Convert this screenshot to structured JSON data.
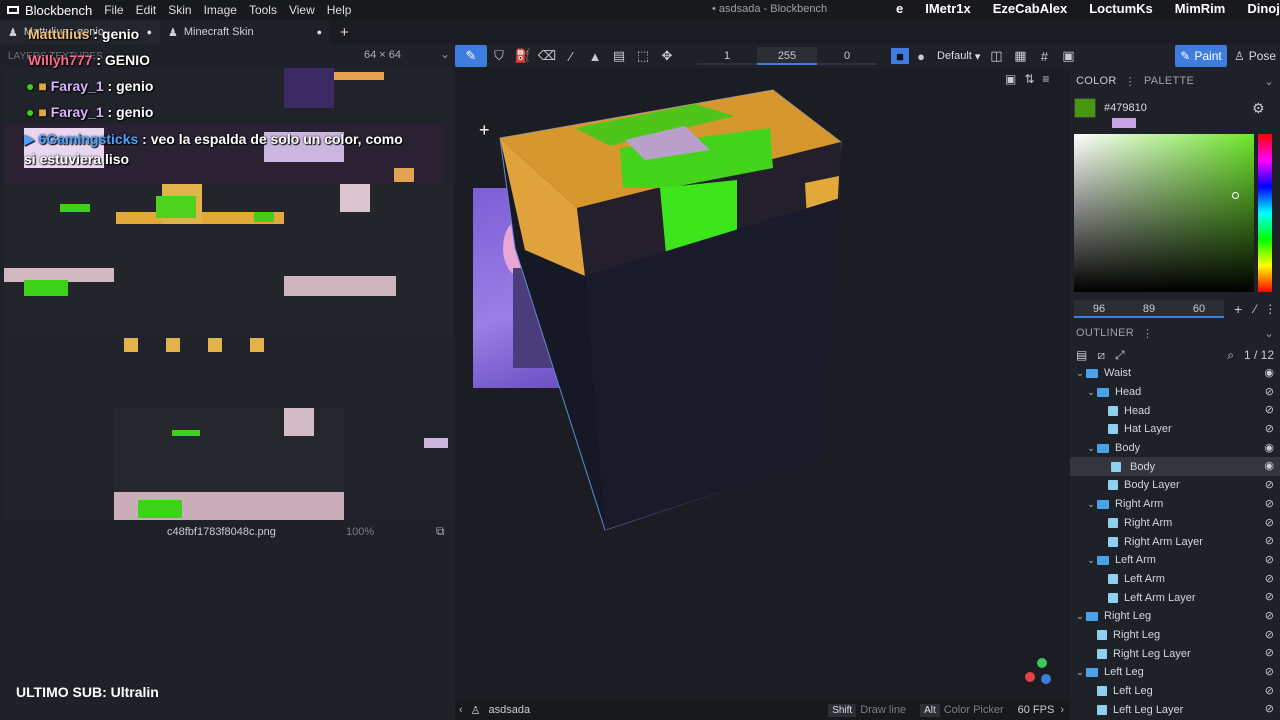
{
  "app": {
    "name": "Blockbench",
    "window_title": "• asdsada - Blockbench"
  },
  "menu": [
    "File",
    "Edit",
    "Skin",
    "Image",
    "Tools",
    "View",
    "Help"
  ],
  "stream_viewers": [
    "e",
    "IMetr1x",
    "EzeCabAlex",
    "LoctumKs",
    "MimRim",
    "Dinoj"
  ],
  "tabs": [
    {
      "label": "Mattulius : genio"
    },
    {
      "label": "Minecraft Skin"
    }
  ],
  "texture_panel": {
    "labels": "LAYERS TEXTURES",
    "size_label": "64 × 64",
    "filename": "c48fbf1783f8048c.png",
    "zoom": "100%"
  },
  "toolbar": {
    "brush_size": "1",
    "opacity": "255",
    "softness": "0",
    "blend_mode": "Default",
    "paint_label": "Paint",
    "pose_label": "Pose"
  },
  "chat": [
    {
      "user": "Mattulius",
      "text": ": genio",
      "color": "#f0c27a"
    },
    {
      "user": "Willyh777",
      "text": ": GENIO",
      "color": "#ff6b8a"
    },
    {
      "user": "Faray_1",
      "text": ": genio",
      "color": "#d9b3ff"
    },
    {
      "user": "Faray_1",
      "text": ": genio",
      "color": "#d9b3ff"
    },
    {
      "user": "6Gamingsticks",
      "text": ": veo la espalda de solo un color, como si estuviera liso",
      "color": "#4ba3ff"
    }
  ],
  "last_sub": "ULTIMO SUB: Ultralin",
  "color_panel": {
    "title": "COLOR",
    "tab2": "PALETTE",
    "hex": "#479810",
    "primary": "#479810",
    "secondary": "#c9a3e6",
    "h": "96",
    "s": "89",
    "v": "60"
  },
  "outliner": {
    "title": "OUTLINER",
    "count": "1 / 12",
    "items": [
      {
        "label": "Waist",
        "type": "group",
        "level": 0
      },
      {
        "label": "Head",
        "type": "group",
        "level": 1
      },
      {
        "label": "Head",
        "type": "cube",
        "level": 2
      },
      {
        "label": "Hat Layer",
        "type": "cube",
        "level": 2
      },
      {
        "label": "Body",
        "type": "group",
        "level": 1
      },
      {
        "label": "Body",
        "type": "cube",
        "level": 2,
        "selected": true
      },
      {
        "label": "Body Layer",
        "type": "cube",
        "level": 2
      },
      {
        "label": "Right Arm",
        "type": "group",
        "level": 1
      },
      {
        "label": "Right Arm",
        "type": "cube",
        "level": 2
      },
      {
        "label": "Right Arm Layer",
        "type": "cube",
        "level": 2
      },
      {
        "label": "Left Arm",
        "type": "group",
        "level": 1
      },
      {
        "label": "Left Arm",
        "type": "cube",
        "level": 2
      },
      {
        "label": "Left Arm Layer",
        "type": "cube",
        "level": 2
      },
      {
        "label": "Right Leg",
        "type": "group",
        "level": 0
      },
      {
        "label": "Right Leg",
        "type": "cube",
        "level": 1
      },
      {
        "label": "Right Leg Layer",
        "type": "cube",
        "level": 1
      },
      {
        "label": "Left Leg",
        "type": "group",
        "level": 0
      },
      {
        "label": "Left Leg",
        "type": "cube",
        "level": 1
      },
      {
        "label": "Left Leg Layer",
        "type": "cube",
        "level": 1
      }
    ]
  },
  "status_bar": {
    "project": "asdsada",
    "shift_key": "Shift",
    "shift_action": "Draw line",
    "alt_key": "Alt",
    "alt_action": "Color Picker",
    "fps": "60 FPS"
  }
}
